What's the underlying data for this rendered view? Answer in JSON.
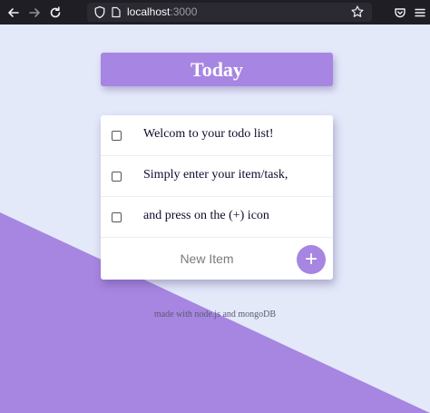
{
  "browser": {
    "url_host": "localhost",
    "url_port": ":3000"
  },
  "colors": {
    "accent": "#a785e2",
    "background": "#e4e9fa",
    "card": "#ffffff"
  },
  "heading": {
    "title": "Today"
  },
  "todos": [
    {
      "text": "Welcom to your todo list!",
      "checked": false
    },
    {
      "text": "Simply enter your item/task,",
      "checked": false
    },
    {
      "text": "and press on the (+) icon",
      "checked": false
    }
  ],
  "new_item": {
    "placeholder": "New Item",
    "add_label": "+"
  },
  "footer": {
    "text": "made with node.js and mongoDB"
  },
  "icons": {
    "back": "arrow-left-icon",
    "forward": "arrow-right-icon",
    "reload": "reload-icon",
    "shield": "shield-icon",
    "page": "page-icon",
    "bookmark": "star-icon",
    "pocket": "pocket-icon",
    "menu": "hamburger-menu-icon"
  }
}
